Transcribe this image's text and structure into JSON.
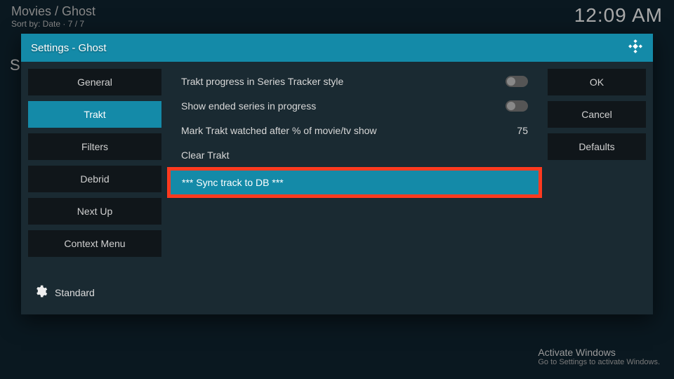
{
  "background": {
    "breadcrumb": "Movies / Ghost",
    "sortline": "Sort by: Date  ·  7 / 7",
    "clock": "12:09 AM",
    "stray": "S"
  },
  "dialog": {
    "title": "Settings - Ghost",
    "categories": [
      {
        "label": "General",
        "selected": false
      },
      {
        "label": "Trakt",
        "selected": true
      },
      {
        "label": "Filters",
        "selected": false
      },
      {
        "label": "Debrid",
        "selected": false
      },
      {
        "label": "Next Up",
        "selected": false
      },
      {
        "label": "Context Menu",
        "selected": false
      }
    ],
    "level_label": "Standard",
    "settings": {
      "row0": {
        "label": "Trakt progress in Series Tracker style",
        "type": "toggle",
        "value": false
      },
      "row1": {
        "label": "Show ended series in progress",
        "type": "toggle",
        "value": false
      },
      "row2": {
        "label": "Mark Trakt watched after % of movie/tv show",
        "type": "number",
        "value": "75"
      },
      "row3": {
        "label": "Clear Trakt",
        "type": "action"
      },
      "row4": {
        "label": "*** Sync track to DB ***",
        "type": "action",
        "highlight": true
      }
    },
    "actions": {
      "ok": "OK",
      "cancel": "Cancel",
      "defaults": "Defaults"
    }
  },
  "watermark": {
    "line1": "Activate Windows",
    "line2": "Go to Settings to activate Windows."
  }
}
